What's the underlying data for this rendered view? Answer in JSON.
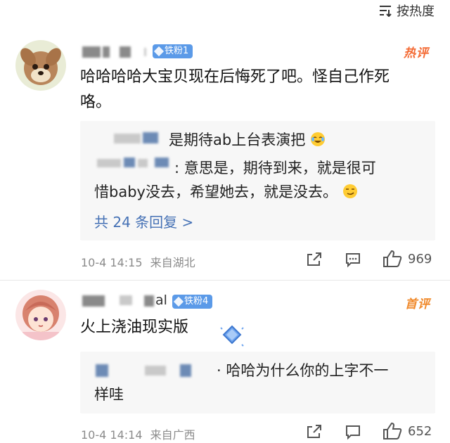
{
  "sort": {
    "label": "按热度",
    "icon": "sort-icon"
  },
  "comments": [
    {
      "level_badge": "铁粉1",
      "hot_label": "热评",
      "text": "哈哈哈哈大宝贝现在后悔死了吧。怪自己作死咯。",
      "text_line1": "哈哈哈哈大宝贝现在后悔死了吧。怪自己作死",
      "text_line2": "咯。",
      "replies": [
        {
          "text": "是期待ab上台表演把",
          "emoji": "laugh-cry-emoji"
        },
        {
          "prefix": ":",
          "line1": "意思是，期待到来，就是很可",
          "line2": "惜baby没去，希望她去，就是没去。",
          "emoji": "smirk-emoji"
        }
      ],
      "more_replies": "共 24 条回复 >",
      "timestamp": "10-4 14:15",
      "source": "来自湖北",
      "likes": "969"
    },
    {
      "name_tail": "al",
      "level_badge": "铁粉4",
      "hot_label": "首评",
      "text": "火上浇油现实版",
      "replies": [
        {
          "prefix": "·",
          "line1": "哈哈为什么你的上字不一",
          "line2": "样哇"
        }
      ],
      "timestamp": "10-4 14:14",
      "source": "来自广西",
      "likes": "652"
    }
  ],
  "colors": {
    "accent": "#4571b5",
    "hot": "#f46b35",
    "badge": "#5b9ae8"
  }
}
